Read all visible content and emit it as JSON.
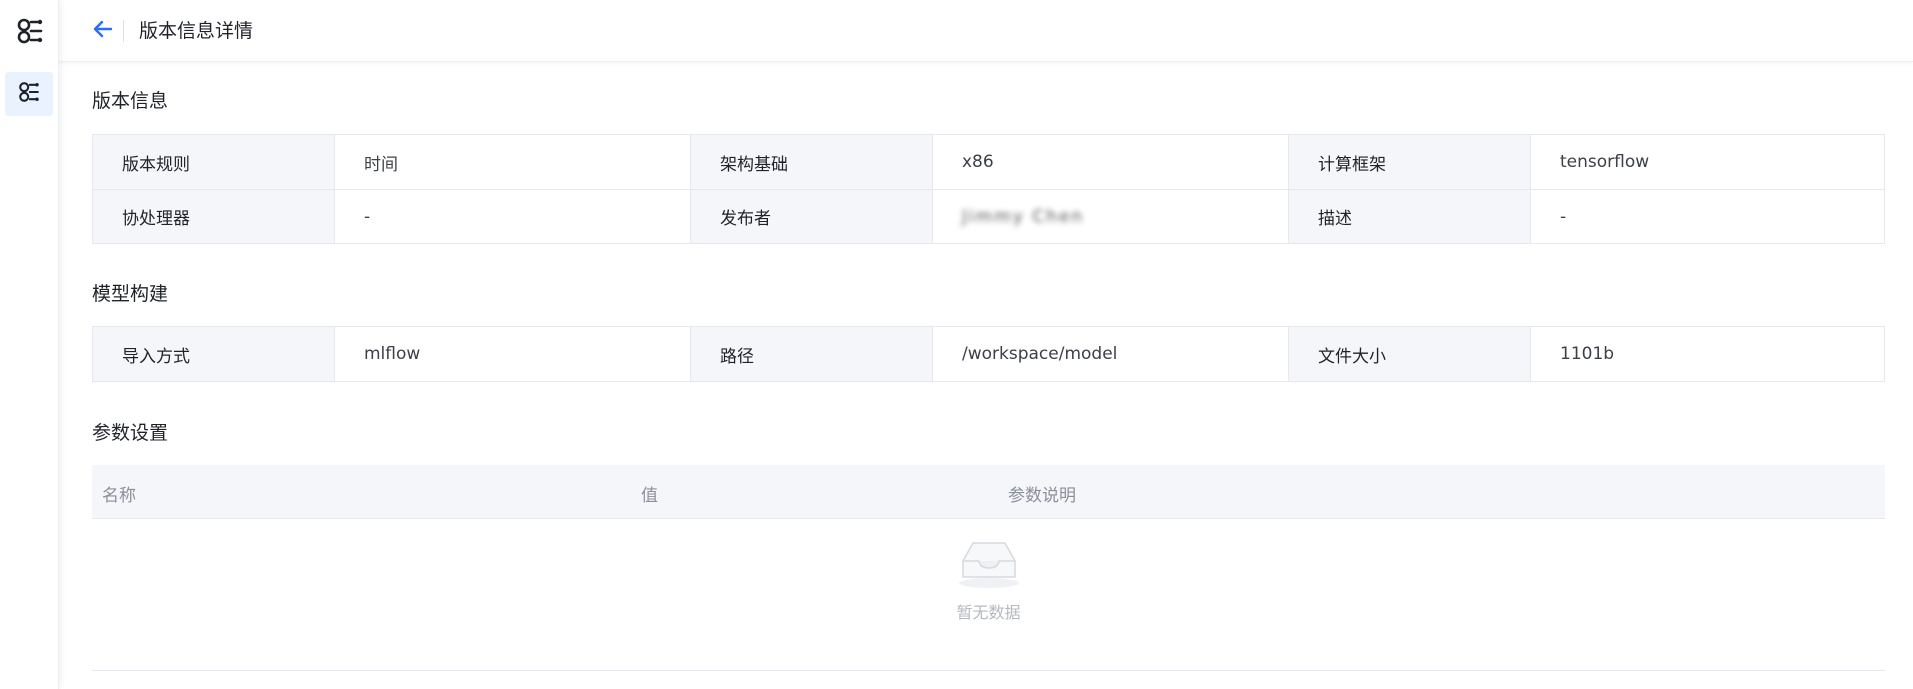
{
  "header": {
    "title": "版本信息详情"
  },
  "sections": {
    "version_info": "版本信息",
    "model_build": "模型构建",
    "params": "参数设置"
  },
  "version_info": {
    "rows": [
      [
        {
          "label": "版本规则",
          "value": "时间"
        },
        {
          "label": "架构基础",
          "value": "x86"
        },
        {
          "label": "计算框架",
          "value": "tensorflow"
        }
      ],
      [
        {
          "label": "协处理器",
          "value": "-"
        },
        {
          "label": "发布者",
          "value": "Jimmy Chen"
        },
        {
          "label": "描述",
          "value": "-"
        }
      ]
    ]
  },
  "model_build": {
    "rows": [
      [
        {
          "label": "导入方式",
          "value": "mlflow"
        },
        {
          "label": "路径",
          "value": "/workspace/model"
        },
        {
          "label": "文件大小",
          "value": "1101b"
        }
      ]
    ]
  },
  "params_table": {
    "columns": [
      "名称",
      "值",
      "参数说明"
    ],
    "empty_text": "暂无数据"
  },
  "colors": {
    "accent": "#2a6ef5",
    "label_bg": "#f5f6fa",
    "border": "#e6e8ee"
  },
  "icons": {
    "logo": "app-logo-icon",
    "nav": "model-nav-icon",
    "back": "arrow-left-icon",
    "empty": "empty-inbox-icon"
  }
}
